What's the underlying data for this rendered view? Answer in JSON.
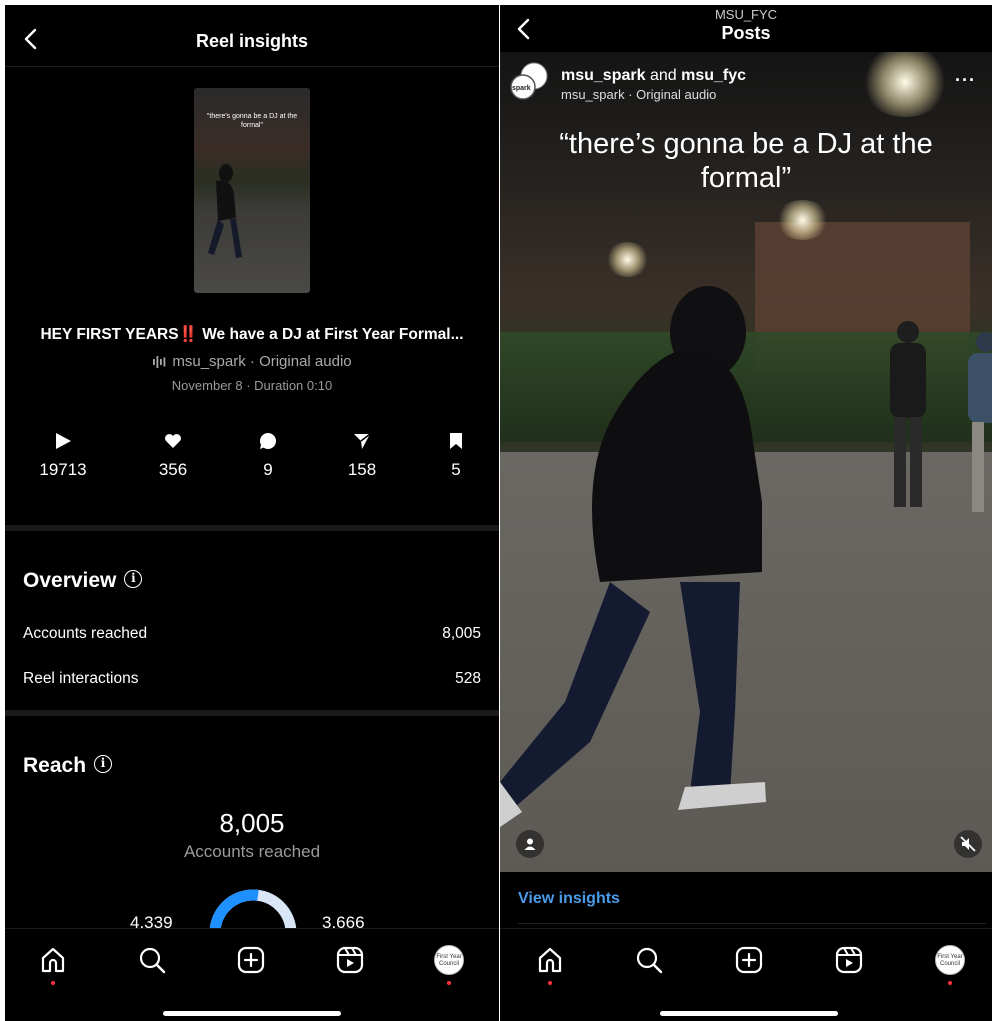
{
  "left": {
    "header": {
      "title": "Reel insights"
    },
    "thumbnail": {
      "caption": "\"there's gonna be a DJ at the formal\""
    },
    "reel": {
      "caption_prefix": "HEY FIRST YEARS",
      "caption_emoji": "‼️",
      "caption_suffix": " We have a DJ at First Year Formal...",
      "audio": "msu_spark · Original audio",
      "meta": "November 8 · Duration 0:10"
    },
    "stats": [
      {
        "icon": "play-icon",
        "value": "19713"
      },
      {
        "icon": "heart-icon",
        "value": "356"
      },
      {
        "icon": "comment-icon",
        "value": "9"
      },
      {
        "icon": "share-icon",
        "value": "158"
      },
      {
        "icon": "bookmark-icon",
        "value": "5"
      }
    ],
    "overview": {
      "title": "Overview",
      "rows": [
        {
          "label": "Accounts reached",
          "value": "8,005"
        },
        {
          "label": "Reel interactions",
          "value": "528"
        }
      ]
    },
    "reach": {
      "title": "Reach",
      "total": "8,005",
      "total_label": "Accounts reached",
      "left_value": "4,339",
      "right_value": "3,666",
      "followers_share": 0.542
    },
    "tabbar": {
      "items": [
        "home-icon",
        "search-icon",
        "create-icon",
        "reels-icon",
        "profile-avatar"
      ],
      "avatar_text": "First Year Council"
    }
  },
  "right": {
    "header": {
      "account": "MSU_FYC",
      "title": "Posts"
    },
    "post": {
      "author1": "msu_spark",
      "joiner": " and ",
      "author2": "msu_fyc",
      "subtitle": "msu_spark · Original audio",
      "avatar_text": "spark",
      "video_caption": "“there’s gonna be a DJ at the formal”"
    },
    "view_insights": "View insights",
    "tabbar": {
      "avatar_text": "First Year Council"
    }
  },
  "colors": {
    "accent_blue": "#4a9be8",
    "gauge_blue": "#1e90ff",
    "notify_red": "#ff3040"
  }
}
